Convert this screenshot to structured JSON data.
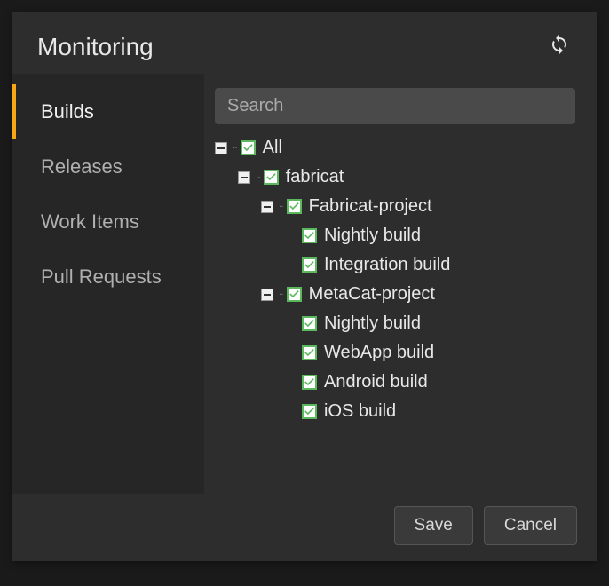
{
  "header": {
    "title": "Monitoring"
  },
  "sidebar": {
    "items": [
      {
        "label": "Builds",
        "active": true
      },
      {
        "label": "Releases",
        "active": false
      },
      {
        "label": "Work Items",
        "active": false
      },
      {
        "label": "Pull Requests",
        "active": false
      }
    ]
  },
  "search": {
    "placeholder": "Search",
    "value": ""
  },
  "tree": {
    "label": "All",
    "checked": true,
    "expanded": true,
    "children": [
      {
        "label": "fabricat",
        "checked": true,
        "expanded": true,
        "children": [
          {
            "label": "Fabricat-project",
            "checked": true,
            "expanded": true,
            "children": [
              {
                "label": "Nightly build",
                "checked": true
              },
              {
                "label": "Integration build",
                "checked": true
              }
            ]
          },
          {
            "label": "MetaCat-project",
            "checked": true,
            "expanded": true,
            "children": [
              {
                "label": "Nightly build",
                "checked": true
              },
              {
                "label": "WebApp build",
                "checked": true
              },
              {
                "label": "Android build",
                "checked": true
              },
              {
                "label": "iOS build",
                "checked": true
              }
            ]
          }
        ]
      }
    ]
  },
  "footer": {
    "save_label": "Save",
    "cancel_label": "Cancel"
  },
  "colors": {
    "accent": "#f7a616",
    "check": "#5cb85c"
  }
}
